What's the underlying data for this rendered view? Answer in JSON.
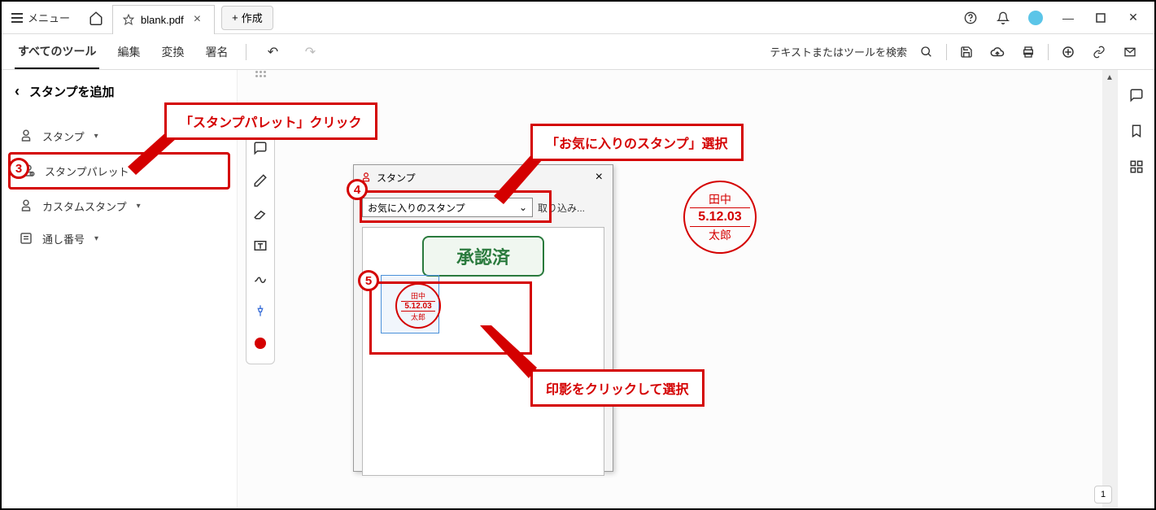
{
  "titlebar": {
    "menu": "メニュー",
    "tab_name": "blank.pdf",
    "create": "作成"
  },
  "toolbar": {
    "all_tools": "すべてのツール",
    "edit": "編集",
    "convert": "変換",
    "sign": "署名",
    "search_placeholder": "テキストまたはツールを検索"
  },
  "left_panel": {
    "title": "スタンプを追加",
    "items": [
      "スタンプ",
      "スタンプパレット",
      "カスタムスタンプ",
      "通し番号"
    ]
  },
  "dialog": {
    "title": "スタンプ",
    "select_value": "お気に入りのスタンプ",
    "import": "取り込み...",
    "approved": "承認済"
  },
  "hanko": {
    "name_top": "田中",
    "date": "5.12.03",
    "name_bot": "太郎"
  },
  "callouts": {
    "c1": "「スタンプパレット」クリック",
    "c2": "「お気に入りのスタンプ」選択",
    "c3": "印影をクリックして選択"
  },
  "numbers": {
    "n3": "3",
    "n4": "4",
    "n5": "5"
  },
  "page": {
    "current": "1"
  }
}
